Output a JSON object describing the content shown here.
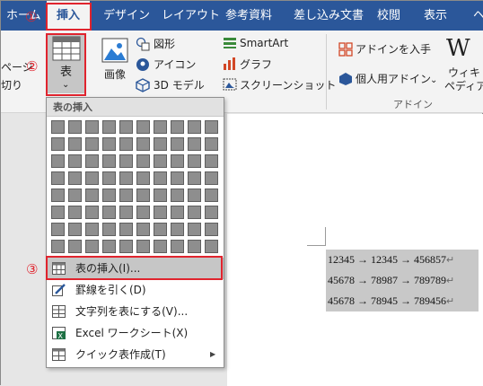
{
  "tabs": [
    "ホーム",
    "挿入",
    "デザイン",
    "レイアウト",
    "参考資料",
    "差し込み文書",
    "校閲",
    "表示",
    "ヘ"
  ],
  "ribbon": {
    "page_lines": [
      "ページ",
      "切り"
    ],
    "table_label": "表",
    "table_arrow": "⌄",
    "picture_label": "画像",
    "shapes": "図形",
    "icons": "アイコン",
    "model3d": "3D モデル",
    "smartart": "SmartArt",
    "graph": "グラフ",
    "screenshot": "スクリーンショット",
    "get_addin": "アドインを入手",
    "my_addin": "個人用アドイン",
    "wiki_icon": "W",
    "wiki_label": [
      "ウィキ",
      "ペディア"
    ],
    "addin_group": "アドイン"
  },
  "table_menu": {
    "header": "表の挿入",
    "items": [
      "表の挿入(I)...",
      "罫線を引く(D)",
      "文字列を表にする(V)...",
      "Excel ワークシート(X)",
      "クイック表作成(T)"
    ],
    "submenu_arrow": "▶"
  },
  "document": {
    "lines": [
      "12345 → 12345 → 456857",
      "45678 → 78987 → 789789",
      "45678 → 78945 → 789456"
    ],
    "pilcrow": "↵"
  },
  "callouts": [
    "①",
    "②",
    "③"
  ],
  "colors": {
    "tab_bar": "#2b579a",
    "callout_red": "#e0242e",
    "selection": "#c8c8c8"
  }
}
